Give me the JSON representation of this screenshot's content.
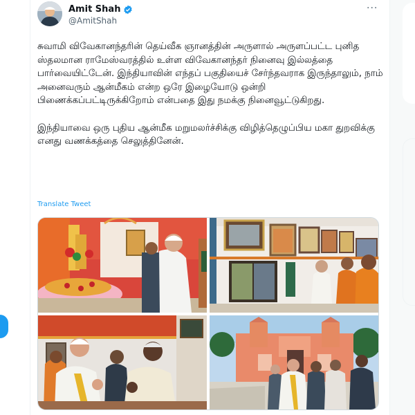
{
  "author": {
    "name": "Amit Shah",
    "handle": "@AmitShah",
    "verified": true
  },
  "actions": {
    "more_icon": "more-dots-icon",
    "more_label": "···"
  },
  "tweet": {
    "text": "சுவாமி விவேகானந்தரின் தெய்வீக ஞானத்தின் அருளால் அருளப்பட்ட புனித ஸ்தலமான ராமேஸ்வரத்தில் உள்ள விவேகானந்தர் நினைவு இல்லத்தை பார்வையிட்டேன். இந்தியாவின் எந்தப் பகுதியைச் சேர்ந்தவராக இருந்தாலும், நாம் அனைவரும் ஆன்மீகம் என்ற ஒரே இழையோடு ஒன்றி பிணைக்கப்பட்டிருக்கிறோம் என்பதை இது நமக்கு நினைவூட்டுகிறது.\n\nஇந்தியாவை ஒரு புதிய ஆன்மீக மறுமலர்ச்சிக்கு விழித்தெழுப்பிய மகா துறவிக்கு எனது வணக்கத்தை செலுத்தினேன்.",
    "translate_label": "Translate Tweet"
  },
  "colors": {
    "accent": "#1d9bf0",
    "text": "#0f1419",
    "secondary": "#536471"
  }
}
